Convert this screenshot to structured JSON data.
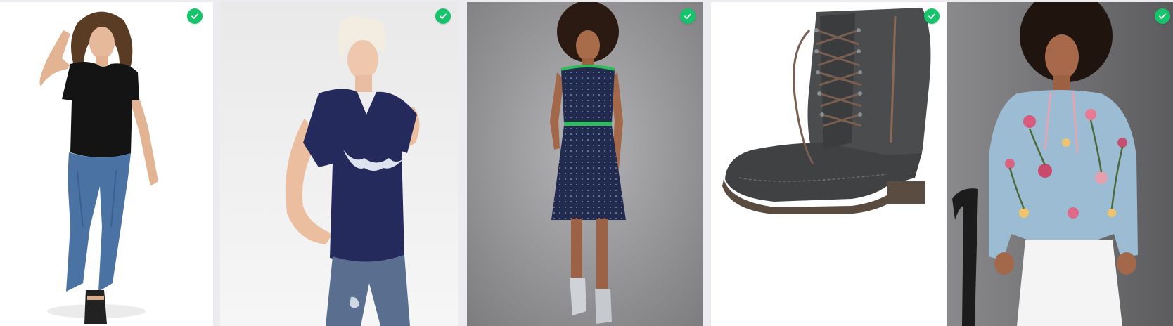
{
  "colors": {
    "page_background": "#ececf0",
    "selected_badge": "#16c46b",
    "checkmark": "#ffffff"
  },
  "gallery": {
    "items": [
      {
        "name": "black-tshirt-jeans",
        "description_icon": "product-photo",
        "background": "#ffffff",
        "selected": true
      },
      {
        "name": "navy-vneck-tshirt",
        "description_icon": "product-photo",
        "background": "#eeeeee",
        "selected": true
      },
      {
        "name": "navy-polka-dot-dress",
        "description_icon": "product-photo",
        "background": "#9a9a9c",
        "selected": true
      },
      {
        "name": "grey-lace-up-boot",
        "description_icon": "product-photo",
        "background": "#ffffff",
        "selected": true
      },
      {
        "name": "floral-blouse",
        "description_icon": "product-photo",
        "background": "#6e6e70",
        "selected": true
      }
    ]
  }
}
